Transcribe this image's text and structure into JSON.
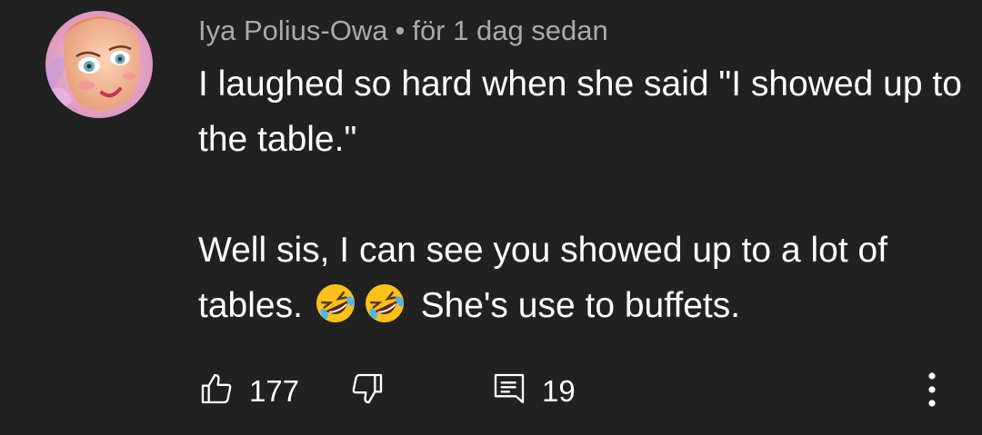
{
  "comment": {
    "author": "Iya Polius-Owa",
    "separator": "•",
    "time": "för 1 dag sedan",
    "paragraphs": [
      "I laughed so hard when she said \"I showed up to the table.\"",
      "Well sis, I can see you showed up to a lot of tables."
    ],
    "trailing_text": "She's use to buffets.",
    "emojis": [
      "rolling-on-floor-laughing-emoji",
      "rolling-on-floor-laughing-emoji"
    ]
  },
  "actions": {
    "like_count": "177",
    "reply_count": "19",
    "icons": [
      "thumbs-up-icon",
      "thumbs-down-icon",
      "reply-icon",
      "more-vert-icon"
    ]
  },
  "colors": {
    "background": "#212121",
    "text": "#ffffff",
    "meta_text": "#aaaaaa"
  }
}
